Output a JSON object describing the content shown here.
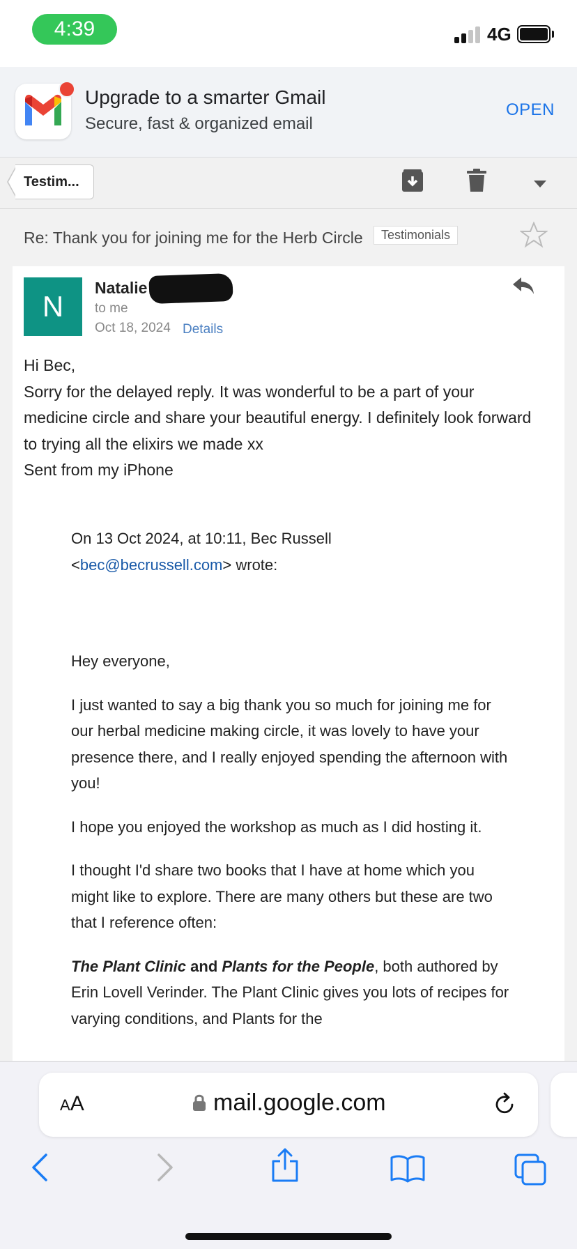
{
  "status_bar": {
    "time": "4:39",
    "network": "4G"
  },
  "promo": {
    "title": "Upgrade to a smarter Gmail",
    "subtitle": "Secure, fast & organized email",
    "open_label": "OPEN"
  },
  "toolbar": {
    "back_label": "Testim..."
  },
  "thread": {
    "subject": "Re: Thank you for joining me for the Herb Circle",
    "label": "Testimonials"
  },
  "message": {
    "avatar_letter": "N",
    "sender": "Natalie",
    "to": "to me",
    "date": "Oct 18, 2024",
    "details_link": "Details",
    "body_lines": [
      "Hi Bec,",
      "Sorry for the delayed reply. It was wonderful to be a part of your",
      "medicine circle and share your beautiful energy. I definitely look forward",
      "to trying all the elixirs we made xx",
      "Sent from my iPhone"
    ],
    "quote_header_line1": "On 13 Oct 2024, at 10:11, Bec Russell",
    "quote_email": "bec@becrussell.com",
    "quote_wrote": " wrote:",
    "quote_greeting": "Hey everyone,",
    "quote_p1": "I just wanted to say a big thank you so much for joining me for our herbal medicine making circle, it was lovely to have your presence there, and I really enjoyed spending the afternoon with you!",
    "quote_p2": "I hope you enjoyed the workshop as much as I did hosting it.",
    "quote_p3": "I thought I'd share two books that I have at home which you might like to explore. There are many others but these are two that I reference often:",
    "book1": "The Plant Clinic",
    "book_and": " and ",
    "book2": "Plants for the People",
    "quote_p4_rest": ", both authored by Erin Lovell Verinder. The Plant Clinic gives you lots of recipes for varying conditions, and Plants for the"
  },
  "browser": {
    "aa_big": "A",
    "aa_small": "A",
    "url": "mail.google.com"
  },
  "colors": {
    "avatar": "#0e9384",
    "link": "#1a5aa8",
    "accent": "#1a73e8",
    "status_pill": "#34c759"
  }
}
